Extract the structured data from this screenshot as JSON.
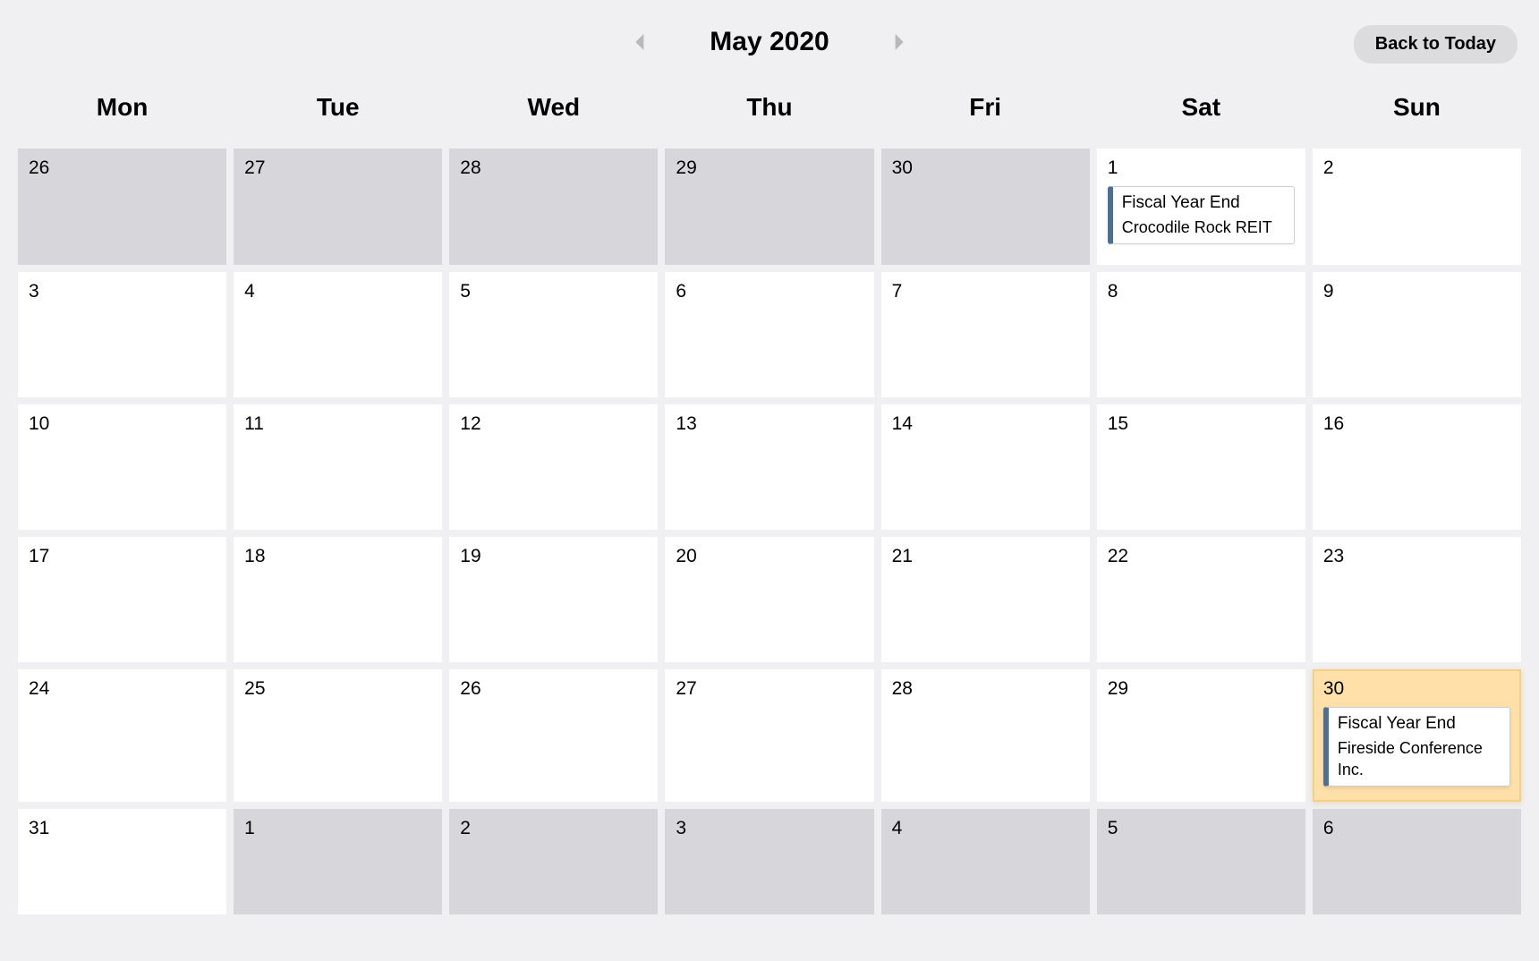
{
  "header": {
    "month_title": "May 2020",
    "back_to_today": "Back to Today"
  },
  "weekdays": [
    "Mon",
    "Tue",
    "Wed",
    "Thu",
    "Fri",
    "Sat",
    "Sun"
  ],
  "colors": {
    "event_accent": "#4d6f92",
    "highlight_bg": "#ffe0a8"
  },
  "events": {
    "e1": {
      "title": "Fiscal Year End",
      "sub": "Crocodile Rock REIT"
    },
    "e2": {
      "title": "Fiscal Year End",
      "sub": "Fireside Conference Inc."
    }
  },
  "grid": [
    [
      {
        "num": "26",
        "other": true
      },
      {
        "num": "27",
        "other": true
      },
      {
        "num": "28",
        "other": true
      },
      {
        "num": "29",
        "other": true
      },
      {
        "num": "30",
        "other": true
      },
      {
        "num": "1",
        "event": "e1"
      },
      {
        "num": "2"
      }
    ],
    [
      {
        "num": "3"
      },
      {
        "num": "4"
      },
      {
        "num": "5"
      },
      {
        "num": "6"
      },
      {
        "num": "7"
      },
      {
        "num": "8"
      },
      {
        "num": "9"
      }
    ],
    [
      {
        "num": "10"
      },
      {
        "num": "11"
      },
      {
        "num": "12"
      },
      {
        "num": "13"
      },
      {
        "num": "14"
      },
      {
        "num": "15"
      },
      {
        "num": "16"
      }
    ],
    [
      {
        "num": "17"
      },
      {
        "num": "18"
      },
      {
        "num": "19"
      },
      {
        "num": "20"
      },
      {
        "num": "21"
      },
      {
        "num": "22"
      },
      {
        "num": "23"
      }
    ],
    [
      {
        "num": "24"
      },
      {
        "num": "25"
      },
      {
        "num": "26"
      },
      {
        "num": "27"
      },
      {
        "num": "28"
      },
      {
        "num": "29"
      },
      {
        "num": "30",
        "highlighted": true,
        "event": "e2"
      }
    ],
    [
      {
        "num": "31"
      },
      {
        "num": "1",
        "other": true
      },
      {
        "num": "2",
        "other": true
      },
      {
        "num": "3",
        "other": true
      },
      {
        "num": "4",
        "other": true
      },
      {
        "num": "5",
        "other": true
      },
      {
        "num": "6",
        "other": true
      }
    ]
  ]
}
